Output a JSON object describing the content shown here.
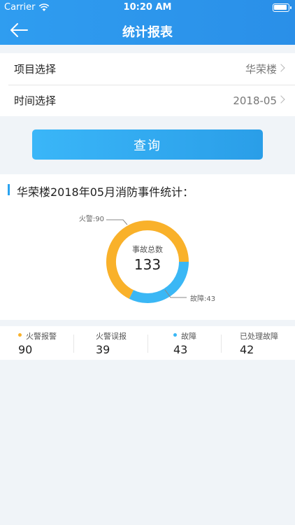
{
  "status": {
    "carrier": "Carrier",
    "time": "10:20 AM"
  },
  "nav": {
    "title": "统计报表"
  },
  "filters": {
    "project_label": "项目选择",
    "project_value": "华荣楼",
    "time_label": "时间选择",
    "time_value": "2018-05"
  },
  "query_button": "查询",
  "stats": {
    "title": "华荣楼2018年05月消防事件统计：",
    "center_label": "事故总数",
    "center_value": "133"
  },
  "colors": {
    "fire_alarm": "#f9b12a",
    "fault": "#3ab7f5",
    "accent": "#2a9ee8"
  },
  "legend": [
    {
      "name": "火警报警",
      "value": "90",
      "dot": "#f9b12a"
    },
    {
      "name": "火警误报",
      "value": "39",
      "dot": ""
    },
    {
      "name": "故障",
      "value": "43",
      "dot": "#3ab7f5"
    },
    {
      "name": "已处理故障",
      "value": "42",
      "dot": ""
    }
  ],
  "chart_data": {
    "type": "pie",
    "title": "",
    "categories": [
      "火警",
      "故障"
    ],
    "values": [
      90,
      43
    ],
    "labels": [
      "火警:90",
      "故障:43"
    ],
    "total": 133,
    "colors": [
      "#f9b12a",
      "#3ab7f5"
    ],
    "donut": true
  }
}
